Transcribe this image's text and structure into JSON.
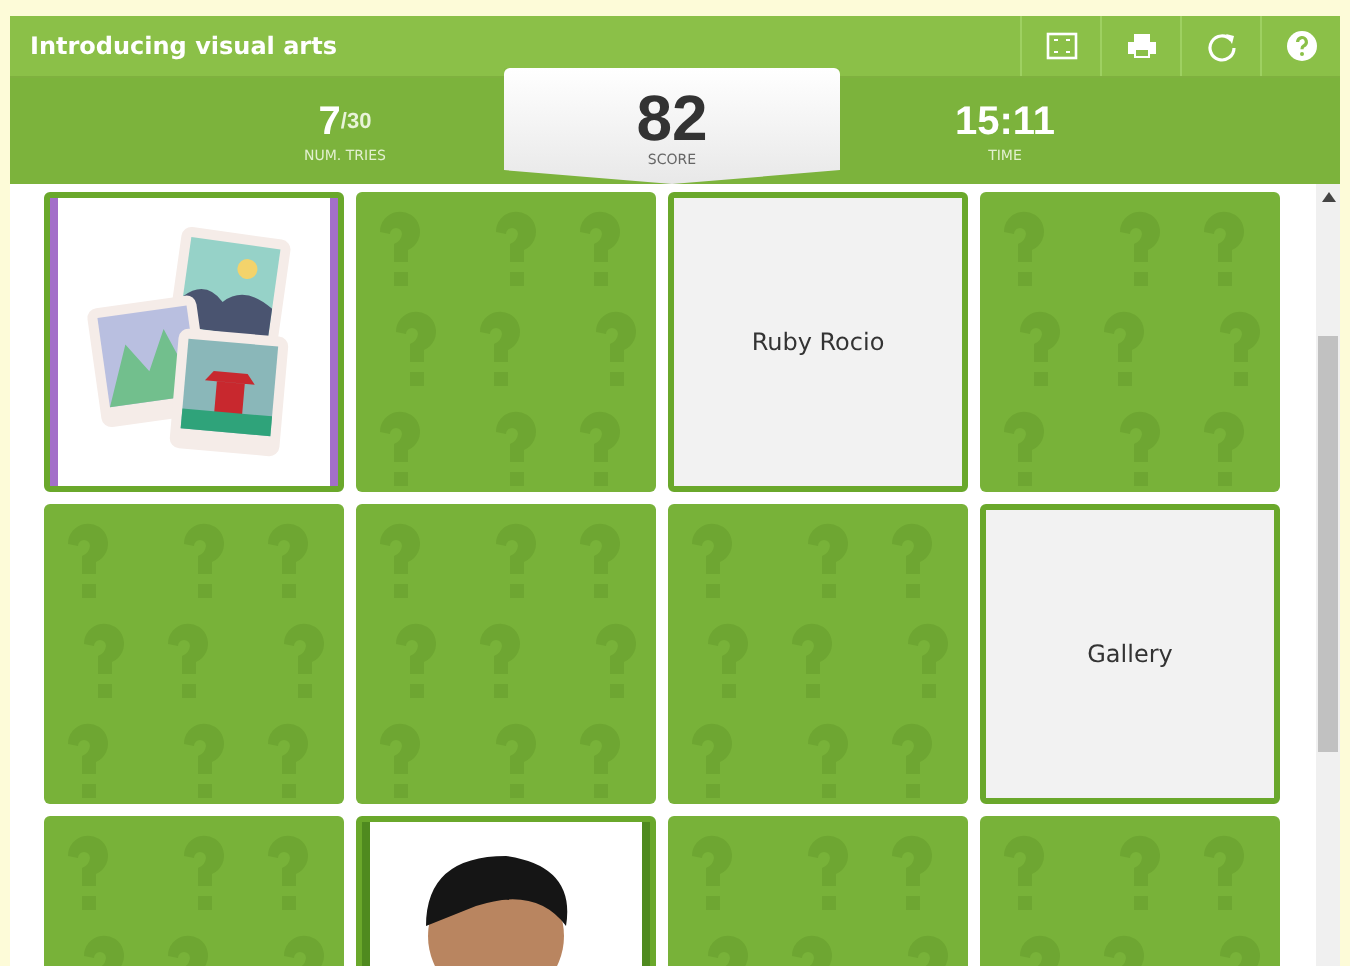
{
  "window": {
    "title": "Introducing visual arts"
  },
  "toolbar": [
    {
      "kind": "fullscreen"
    },
    {
      "kind": "print"
    },
    {
      "kind": "restart"
    },
    {
      "kind": "help"
    }
  ],
  "stats": {
    "tries": "7",
    "tries_max": "/30",
    "tries_label": "NUM. TRIES",
    "score": "82",
    "score_label": "SCORE",
    "time": "15:11",
    "time_label": "TIME"
  },
  "cards": [
    {
      "kind": "art",
      "color": "#a36fc9"
    },
    {
      "kind": "back"
    },
    {
      "kind": "text",
      "text": "Ruby Rocio"
    },
    {
      "kind": "back"
    },
    {
      "kind": "back"
    },
    {
      "kind": "back"
    },
    {
      "kind": "back"
    },
    {
      "kind": "text",
      "text": "Gallery"
    },
    {
      "kind": "back"
    },
    {
      "kind": "avatar",
      "color": "#4f8a1f"
    },
    {
      "kind": "back"
    },
    {
      "kind": "back"
    }
  ]
}
